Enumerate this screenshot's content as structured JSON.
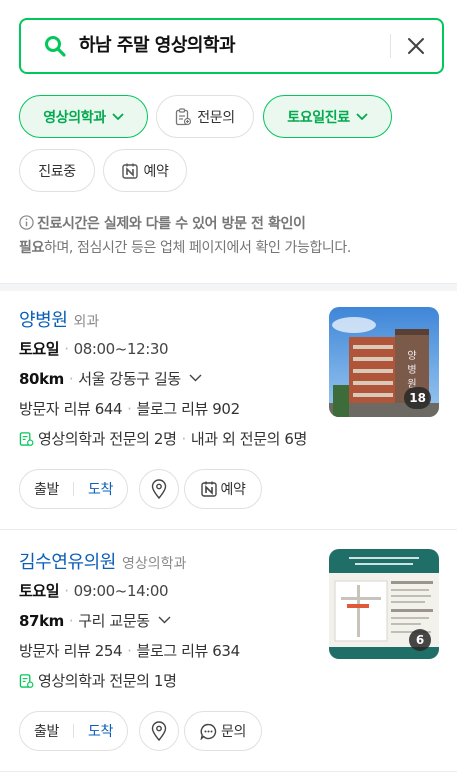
{
  "search": {
    "query": "하남 주말 영상의학과"
  },
  "filters": [
    {
      "label": "영상의학과",
      "active": true,
      "dropdown": true
    },
    {
      "label": "전문의",
      "active": false,
      "icon": "doctor-clipboard-icon"
    },
    {
      "label": "토요일진료",
      "active": true,
      "dropdown": true
    },
    {
      "label": "진료중",
      "active": false
    },
    {
      "label": "예약",
      "active": false,
      "icon": "naver-n-icon"
    }
  ],
  "notice": {
    "bold1": "진료시간은 실제와 다를 수 있어 방문 전 확인이",
    "bold2": "필요",
    "rest": "하며, 점심시간 등은 업체 페이지에서 확인 가능합니다."
  },
  "places": [
    {
      "name": "양병원",
      "category": "외과",
      "day": "토요일",
      "hours": "08:00~12:30",
      "distance": "80km",
      "address": "서울 강동구 길동",
      "visitor_reviews": "방문자 리뷰 644",
      "blog_reviews": "블로그 리뷰 902",
      "specialists": "영상의학과 전문의 2명",
      "specialists_extra": "내과 외 전문의 6명",
      "photo_count": "18",
      "btn_depart": "출발",
      "btn_arrive": "도착",
      "btn_action": "예약",
      "action_icon": "naver-n-icon"
    },
    {
      "name": "김수연유의원",
      "category": "영상의학과",
      "day": "토요일",
      "hours": "09:00~14:00",
      "distance": "87km",
      "address": "구리 교문동",
      "visitor_reviews": "방문자 리뷰 254",
      "blog_reviews": "블로그 리뷰 634",
      "specialists": "영상의학과 전문의 1명",
      "photo_count": "6",
      "btn_depart": "출발",
      "btn_arrive": "도착",
      "btn_action": "문의",
      "action_icon": "chat-bubble-icon"
    }
  ],
  "colors": {
    "accent_green": "#03c75a",
    "link_blue": "#0b5fb8"
  }
}
